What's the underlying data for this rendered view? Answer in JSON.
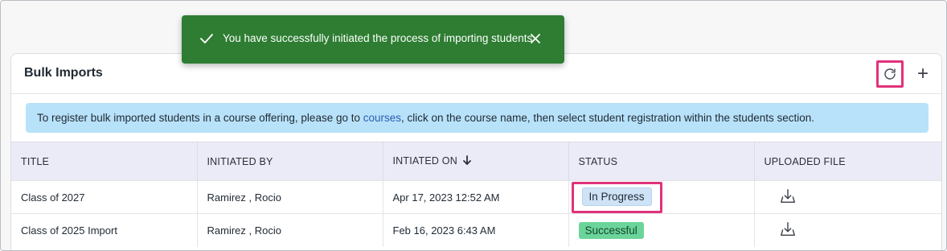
{
  "toast": {
    "message": "You have successfully initiated the process of importing students",
    "check_icon": "check-icon",
    "close_icon": "close-icon",
    "color": "#2e7d32"
  },
  "card": {
    "title": "Bulk Imports",
    "refresh_icon": "refresh-icon",
    "add_icon": "plus-icon",
    "add_symbol": "+"
  },
  "banner": {
    "text_before": "To register bulk imported students in a course offering, please go to ",
    "link": "courses",
    "text_after": ", click on the course name, then select student registration within the students section."
  },
  "table": {
    "headers": [
      "TITLE",
      "INITIATED BY",
      "INTIATED ON",
      "STATUS",
      "UPLOADED FILE"
    ],
    "rows": [
      {
        "title": "Class of 2027",
        "initiated_by": "Ramirez , Rocio",
        "initiated_on": "Apr 17, 2023 12:52 AM",
        "status": "In Progress"
      },
      {
        "title": "Class of 2025 Import",
        "initiated_by": "Ramirez , Rocio",
        "initiated_on": "Feb 16, 2023 6:43 AM",
        "status": "Successful"
      }
    ]
  },
  "colors": {
    "highlight": "#e0337a",
    "status_in_progress": "#cfe3f7",
    "status_successful": "#6bd49a",
    "banner": "#b8e2fa",
    "header_row": "#ebebf7"
  }
}
